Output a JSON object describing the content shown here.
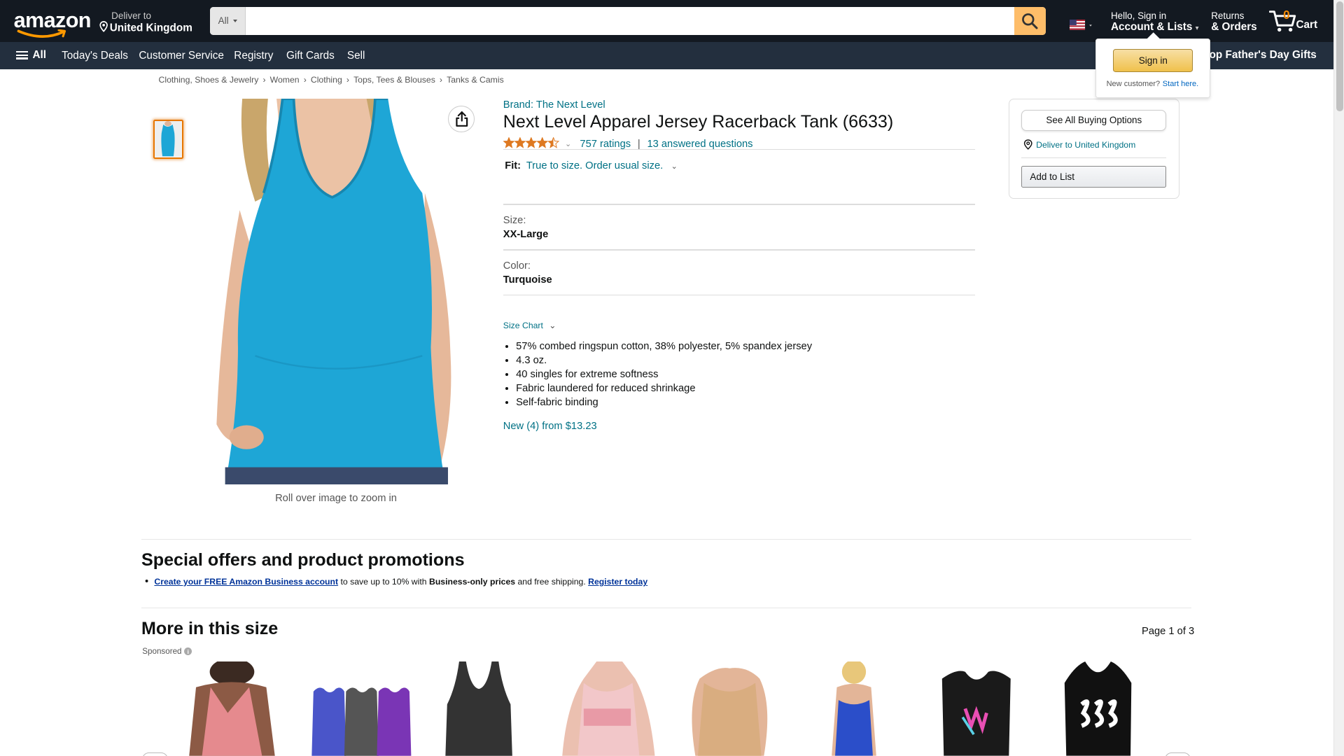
{
  "header": {
    "logo": "amazon",
    "deliver_line1": "Deliver to",
    "deliver_line2": "United Kingdom",
    "search_dept": "All",
    "search_placeholder": "",
    "account_line1": "Hello, Sign in",
    "account_line2": "Account & Lists",
    "returns_line1": "Returns",
    "returns_line2": "& Orders",
    "cart_count": "0",
    "cart_label": "Cart",
    "accent_color": "#febd69"
  },
  "subnav": {
    "all_label": "All",
    "items": [
      "Today's Deals",
      "Customer Service",
      "Registry",
      "Gift Cards",
      "Sell"
    ],
    "promo": "Shop Father's Day Gifts"
  },
  "signin_flyout": {
    "button": "Sign in",
    "new_customer": "New customer?",
    "start_here": "Start here."
  },
  "breadcrumbs": [
    "Clothing, Shoes & Jewelry",
    "Women",
    "Clothing",
    "Tops, Tees & Blouses",
    "Tanks & Camis"
  ],
  "gallery": {
    "zoom_hint": "Roll over image to zoom in",
    "product_color": "#1ea6d6"
  },
  "product": {
    "brand": "Brand: The Next Level",
    "title": "Next Level Apparel Jersey Racerback Tank (6633)",
    "rating_stars": 4.5,
    "ratings": "757 ratings",
    "separator": "|",
    "answered": "13 answered questions",
    "fit_label": "Fit:",
    "fit_value": "True to size. Order usual size.",
    "size_label": "Size:",
    "size_value": "XX-Large",
    "color_label": "Color:",
    "color_value": "Turquoise",
    "size_chart": "Size Chart",
    "bullets": [
      "57% combed ringspun cotton, 38% polyester, 5% spandex jersey",
      "4.3 oz.",
      "40 singles for extreme softness",
      "Fabric laundered for reduced shrinkage",
      "Self-fabric binding"
    ],
    "new_from": "New (4) from $13.23"
  },
  "buybox": {
    "see_all": "See All Buying Options",
    "deliver": "Deliver to United Kingdom",
    "add_to_list": "Add to List"
  },
  "promotions": {
    "heading": "Special offers and product promotions",
    "link1": "Create your FREE Amazon Business account",
    "text1": "to save up to 10% with",
    "bold": "Business-only prices",
    "text2": "and free shipping.",
    "link2": "Register today"
  },
  "more": {
    "heading": "More in this size",
    "page": "Page 1 of 3",
    "sponsored": "Sponsored",
    "products": [
      {
        "icon": "pink-racerback-tank",
        "color": "#e58a8e"
      },
      {
        "icon": "three-pack-tanks",
        "color": "#4a55c9"
      },
      {
        "icon": "black-space-dye-tank",
        "color": "#333333"
      },
      {
        "icon": "pink-workout-tank",
        "color": "#f2c7c9"
      },
      {
        "icon": "tan-ribbed-tank",
        "color": "#d9ad80"
      },
      {
        "icon": "royal-blue-tank",
        "color": "#2b4ec9"
      },
      {
        "icon": "black-graphic-tank",
        "color": "#1a1a1a"
      },
      {
        "icon": "black-333-tank",
        "color": "#111111"
      }
    ]
  }
}
